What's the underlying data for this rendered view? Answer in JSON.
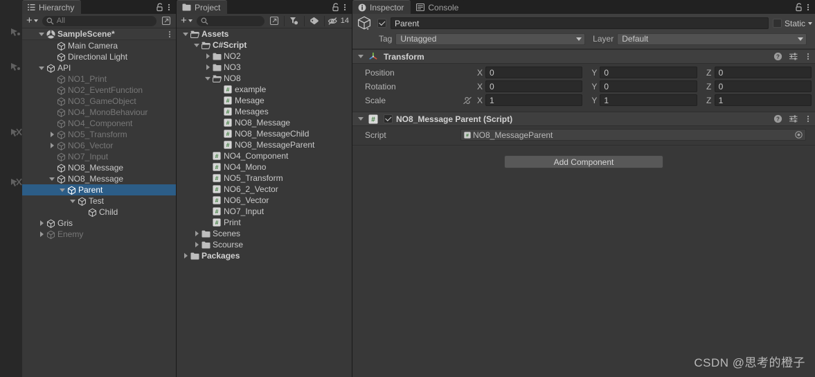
{
  "colors": {
    "selection_blue": "#2c5d87",
    "panel_bg": "#383838",
    "header_bg": "#3f3f3f",
    "tabbar_bg": "#212121",
    "csharp_green": "#4b8b4b"
  },
  "hierarchy": {
    "tab_label": "Hierarchy",
    "search_placeholder": "All",
    "scene_name": "SampleScene*",
    "items": [
      {
        "label": "Main Camera",
        "depth": 2,
        "fold": "none",
        "state": "normal"
      },
      {
        "label": "Directional Light",
        "depth": 2,
        "fold": "none",
        "state": "normal"
      },
      {
        "label": "API",
        "depth": 1,
        "fold": "open",
        "state": "normal"
      },
      {
        "label": "NO1_Print",
        "depth": 2,
        "fold": "none",
        "state": "dim"
      },
      {
        "label": "NO2_EventFunction",
        "depth": 2,
        "fold": "none",
        "state": "dim"
      },
      {
        "label": "NO3_GameObject",
        "depth": 2,
        "fold": "none",
        "state": "dim"
      },
      {
        "label": "NO4_MonoBehaviour",
        "depth": 2,
        "fold": "none",
        "state": "dim"
      },
      {
        "label": "NO4_Component",
        "depth": 2,
        "fold": "none",
        "state": "dim"
      },
      {
        "label": "NO5_Transform",
        "depth": 2,
        "fold": "closed",
        "state": "dim"
      },
      {
        "label": "NO6_Vector",
        "depth": 2,
        "fold": "closed",
        "state": "dim"
      },
      {
        "label": "NO7_Input",
        "depth": 2,
        "fold": "none",
        "state": "dim"
      },
      {
        "label": "NO8_Message",
        "depth": 2,
        "fold": "none",
        "state": "normal"
      },
      {
        "label": "NO8_Message",
        "depth": 2,
        "fold": "open",
        "state": "normal"
      },
      {
        "label": "Parent",
        "depth": 3,
        "fold": "open",
        "state": "selected"
      },
      {
        "label": "Test",
        "depth": 4,
        "fold": "open",
        "state": "normal"
      },
      {
        "label": "Child",
        "depth": 5,
        "fold": "none",
        "state": "normal"
      },
      {
        "label": "Gris",
        "depth": 1,
        "fold": "closed",
        "state": "normal"
      },
      {
        "label": "Enemy",
        "depth": 1,
        "fold": "closed",
        "state": "dim"
      }
    ]
  },
  "project": {
    "tab_label": "Project",
    "search_placeholder": "",
    "hidden_count": "14",
    "items": [
      {
        "label": "Assets",
        "depth": 0,
        "fold": "open",
        "kind": "folder-open",
        "state": "bold"
      },
      {
        "label": "C#Script",
        "depth": 1,
        "fold": "open",
        "kind": "folder-open",
        "state": "bold"
      },
      {
        "label": "NO2",
        "depth": 2,
        "fold": "closed",
        "kind": "folder",
        "state": "normal"
      },
      {
        "label": "NO3",
        "depth": 2,
        "fold": "closed",
        "kind": "folder",
        "state": "normal"
      },
      {
        "label": "NO8",
        "depth": 2,
        "fold": "open",
        "kind": "folder-open",
        "state": "normal"
      },
      {
        "label": "example",
        "depth": 3,
        "fold": "none",
        "kind": "cs",
        "state": "normal"
      },
      {
        "label": "Mesage",
        "depth": 3,
        "fold": "none",
        "kind": "cs",
        "state": "normal"
      },
      {
        "label": "Mesages",
        "depth": 3,
        "fold": "none",
        "kind": "cs",
        "state": "normal"
      },
      {
        "label": "NO8_Message",
        "depth": 3,
        "fold": "none",
        "kind": "cs",
        "state": "normal"
      },
      {
        "label": "NO8_MessageChild",
        "depth": 3,
        "fold": "none",
        "kind": "cs",
        "state": "normal"
      },
      {
        "label": "NO8_MessageParent",
        "depth": 3,
        "fold": "none",
        "kind": "cs",
        "state": "normal"
      },
      {
        "label": "NO4_Component",
        "depth": 2,
        "fold": "none",
        "kind": "cs",
        "state": "normal"
      },
      {
        "label": "NO4_Mono",
        "depth": 2,
        "fold": "none",
        "kind": "cs",
        "state": "normal"
      },
      {
        "label": "NO5_Transform",
        "depth": 2,
        "fold": "none",
        "kind": "cs",
        "state": "normal"
      },
      {
        "label": "NO6_2_Vector",
        "depth": 2,
        "fold": "none",
        "kind": "cs",
        "state": "normal"
      },
      {
        "label": "NO6_Vector",
        "depth": 2,
        "fold": "none",
        "kind": "cs",
        "state": "normal"
      },
      {
        "label": "NO7_Input",
        "depth": 2,
        "fold": "none",
        "kind": "cs",
        "state": "normal"
      },
      {
        "label": "Print",
        "depth": 2,
        "fold": "none",
        "kind": "cs",
        "state": "normal"
      },
      {
        "label": "Scenes",
        "depth": 1,
        "fold": "closed",
        "kind": "folder",
        "state": "normal"
      },
      {
        "label": "Scourse",
        "depth": 1,
        "fold": "closed",
        "kind": "folder",
        "state": "normal"
      },
      {
        "label": "Packages",
        "depth": 0,
        "fold": "closed",
        "kind": "folder",
        "state": "bold"
      }
    ]
  },
  "inspector": {
    "tab_label": "Inspector",
    "console_tab_label": "Console",
    "object_name": "Parent",
    "object_enabled": true,
    "static_label": "Static",
    "static_checked": false,
    "tag_label": "Tag",
    "tag_value": "Untagged",
    "layer_label": "Layer",
    "layer_value": "Default",
    "transform": {
      "title": "Transform",
      "rows": [
        {
          "name": "Position",
          "x": "0",
          "y": "0",
          "z": "0",
          "locked": false
        },
        {
          "name": "Rotation",
          "x": "0",
          "y": "0",
          "z": "0",
          "locked": false
        },
        {
          "name": "Scale",
          "x": "1",
          "y": "1",
          "z": "1",
          "locked": true
        }
      ],
      "axis_labels": [
        "X",
        "Y",
        "Z"
      ]
    },
    "script_component": {
      "title": "NO8_Message Parent (Script)",
      "enabled": true,
      "script_prop_label": "Script",
      "script_value": "NO8_MessageParent"
    },
    "add_component_label": "Add Component"
  },
  "watermark": "CSDN @思考的橙子"
}
